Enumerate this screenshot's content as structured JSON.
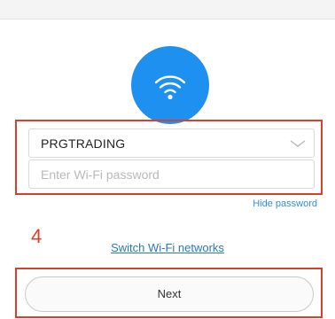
{
  "network": {
    "ssid": "PRGTRADING",
    "password_value": "",
    "password_placeholder": "Enter Wi-Fi password"
  },
  "links": {
    "hide_password": "Hide password",
    "switch_networks": "Switch Wi-Fi networks"
  },
  "annotation": {
    "step_number": "4"
  },
  "actions": {
    "next_label": "Next"
  },
  "icons": {
    "wifi": "wifi-icon",
    "dropdown": "chevron-down-icon"
  },
  "colors": {
    "accent_blue": "#1e90f0",
    "link_blue": "#2577d0",
    "annotation_red": "#d9402b"
  }
}
